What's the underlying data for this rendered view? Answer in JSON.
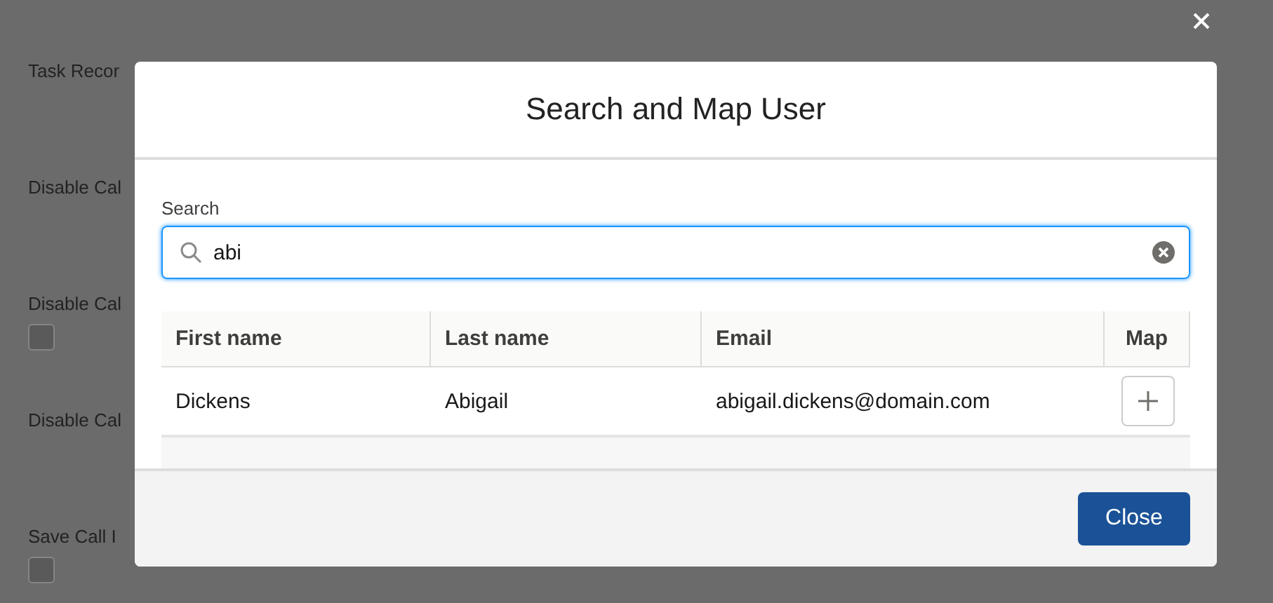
{
  "background": {
    "fields": [
      {
        "label": "Task Recor",
        "kind": "text"
      },
      {
        "label": "Disable Cal",
        "kind": "text"
      },
      {
        "label": "Disable Cal",
        "kind": "checkbox",
        "checked": false
      },
      {
        "label": "Disable Cal",
        "kind": "text"
      },
      {
        "label": "Save Call I",
        "kind": "checkbox",
        "checked": false
      }
    ]
  },
  "modal": {
    "title": "Search and Map User",
    "search": {
      "label": "Search",
      "value": "abi"
    },
    "table": {
      "columns": [
        "First name",
        "Last name",
        "Email",
        "Map"
      ],
      "rows": [
        {
          "cells": [
            "Dickens",
            "Abigail",
            "abigail.dickens@domain.com"
          ]
        }
      ]
    },
    "buttons": [
      "Close"
    ]
  }
}
